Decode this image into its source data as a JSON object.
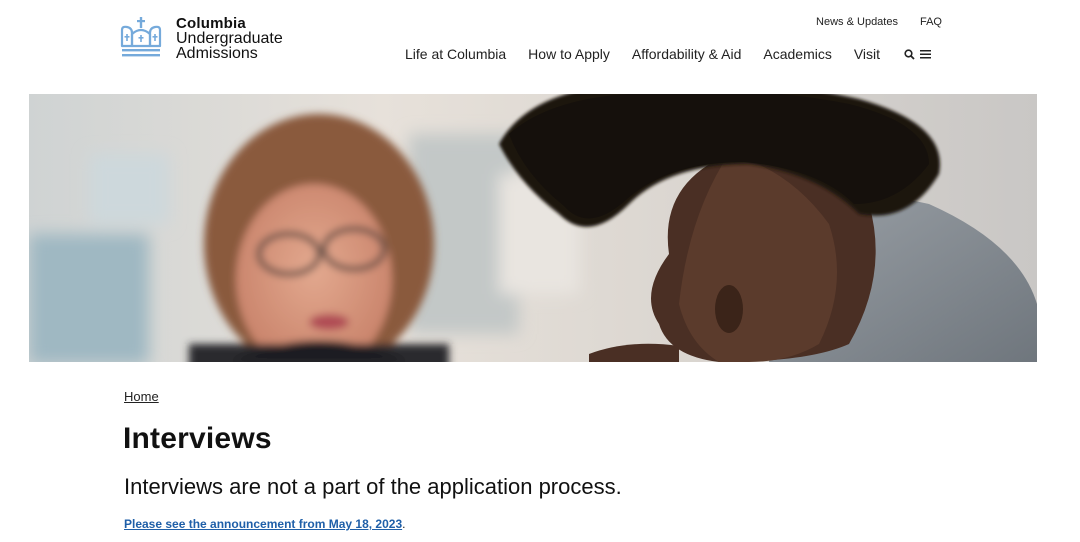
{
  "brand": {
    "line1": "Columbia",
    "line2": "Undergraduate",
    "line3": "Admissions",
    "color": "#75aadb"
  },
  "utility_nav": {
    "news": "News & Updates",
    "faq": "FAQ"
  },
  "main_nav": {
    "items": [
      "Life at Columbia",
      "How to Apply",
      "Affordability & Aid",
      "Academics",
      "Visit"
    ],
    "search_icon": "search-icon",
    "menu_icon": "menu-icon"
  },
  "breadcrumb": {
    "home": "Home"
  },
  "page": {
    "title": "Interviews",
    "lead": "Interviews are not a part of the application process.",
    "note_link": "Please see the announcement from May 18, 2023",
    "note_suffix": "."
  },
  "colors": {
    "link": "#1f5fa8",
    "text": "#111111"
  }
}
